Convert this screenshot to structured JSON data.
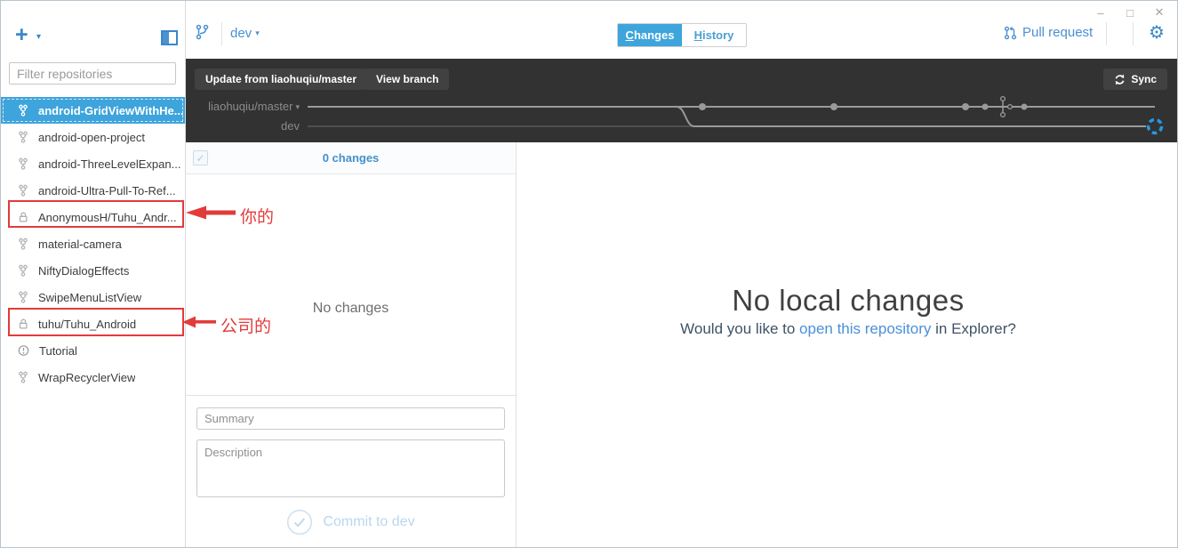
{
  "window": {
    "controls": {
      "minimize": "–",
      "maximize": "□",
      "close": "✕"
    }
  },
  "icons": {
    "plus": "+",
    "caret_down": "▾",
    "gear": "⚙",
    "check": "✓"
  },
  "sidebar": {
    "filter_placeholder": "Filter repositories",
    "repos": [
      {
        "name": "android-GridViewWithHe...",
        "icon": "fork",
        "selected": true
      },
      {
        "name": "android-open-project",
        "icon": "fork"
      },
      {
        "name": "android-ThreeLevelExpan...",
        "icon": "fork"
      },
      {
        "name": "android-Ultra-Pull-To-Ref...",
        "icon": "fork"
      },
      {
        "name": "AnonymousH/Tuhu_Andr...",
        "icon": "lock",
        "annotated": true
      },
      {
        "name": "material-camera",
        "icon": "fork"
      },
      {
        "name": "NiftyDialogEffects",
        "icon": "fork"
      },
      {
        "name": "SwipeMenuListView",
        "icon": "fork"
      },
      {
        "name": "tuhu/Tuhu_Android",
        "icon": "lock",
        "annotated": true
      },
      {
        "name": "Tutorial",
        "icon": "alert"
      },
      {
        "name": "WrapRecyclerView",
        "icon": "fork"
      }
    ]
  },
  "header": {
    "branch_name": "dev",
    "tabs": [
      {
        "label": "Changes",
        "active": true
      },
      {
        "label": "History",
        "active": false
      }
    ],
    "pull_request_label": "Pull request"
  },
  "toolbar": {
    "update_button": "Update from liaohuqiu/master",
    "view_branch_button": "View branch",
    "sync_button": "Sync",
    "branches": [
      {
        "name": "liaohuqiu/master"
      },
      {
        "name": "dev"
      }
    ]
  },
  "changes_panel": {
    "count_label": "0 changes",
    "empty_text": "No changes",
    "summary_placeholder": "Summary",
    "description_placeholder": "Description",
    "commit_button": "Commit to dev"
  },
  "main": {
    "title": "No local changes",
    "subtitle_prefix": "Would you like to ",
    "subtitle_link": "open this repository",
    "subtitle_suffix": " in Explorer?"
  },
  "annotations": [
    {
      "text": "你的"
    },
    {
      "text": "公司的"
    }
  ],
  "colors": {
    "accent_blue": "#3ea4dc",
    "link_blue": "#4a90d2",
    "dark_toolbar": "#323232",
    "annotation_red": "#e23b3b",
    "graph_line": "#9a9a9a"
  }
}
